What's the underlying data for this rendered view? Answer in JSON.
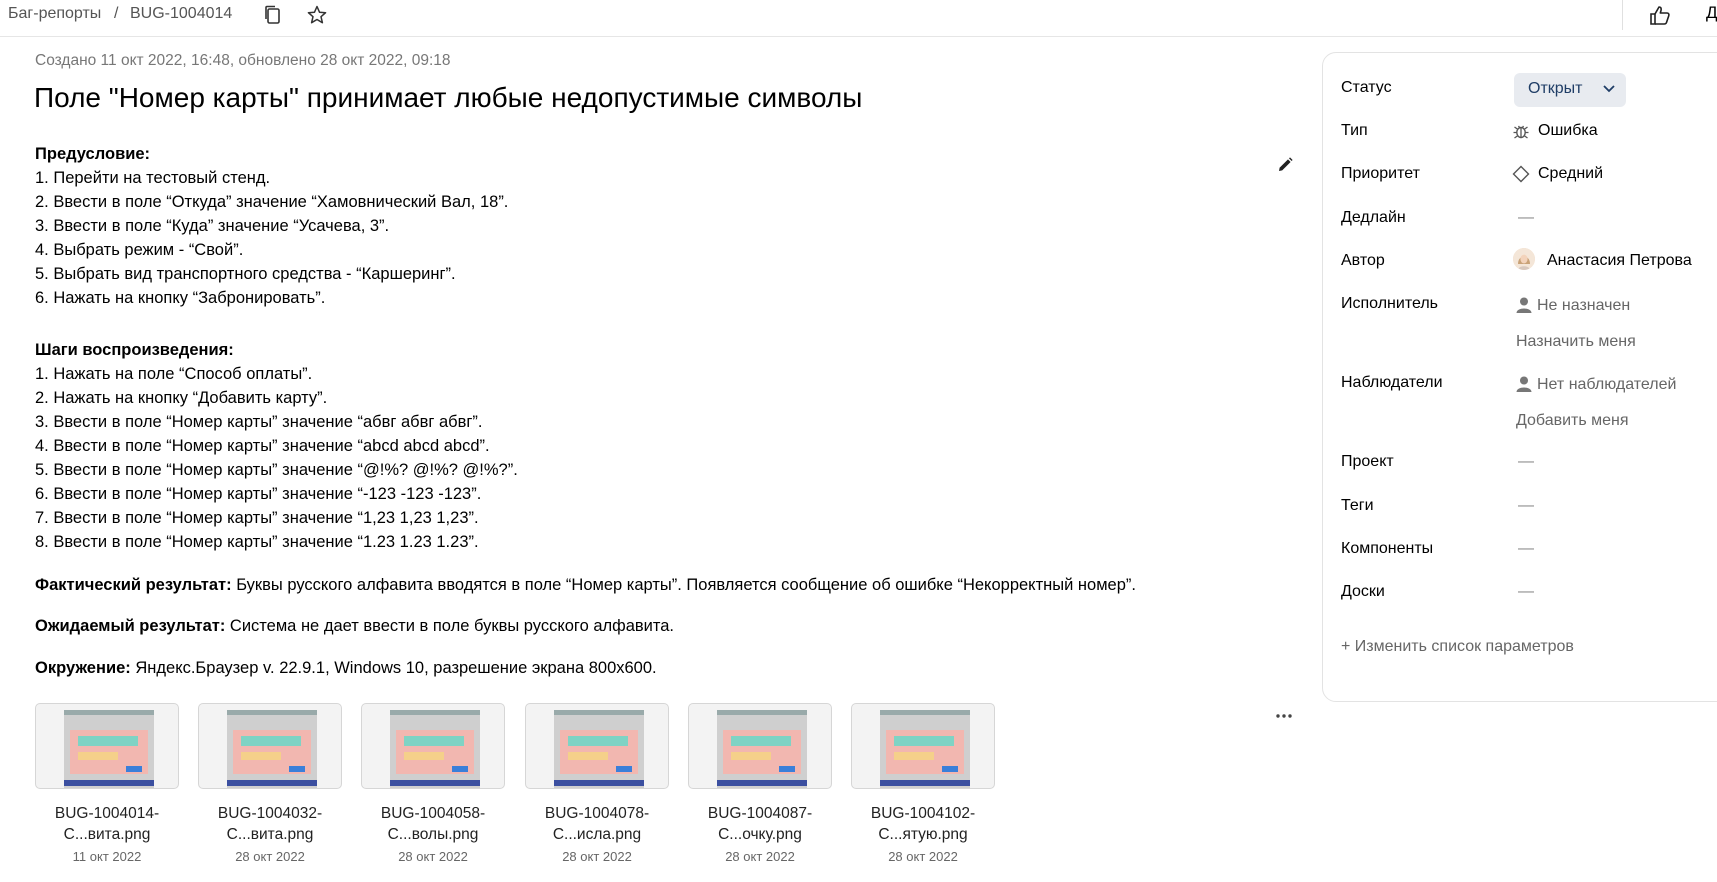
{
  "breadcrumb": {
    "parent": "Баг-репорты",
    "separator": "/",
    "current": "BUG-1004014"
  },
  "top_right_letter": "Д",
  "meta": "Создано 11 окт 2022, 16:48, обновлено 28 окт 2022, 09:18",
  "title": "Поле \"Номер карты\" принимает любые недопустимые символы",
  "precondition": {
    "header": "Предусловие:",
    "items": [
      "1. Перейти на тестовый стенд.",
      "2. Ввести в поле “Откуда” значение “Хамовнический Вал, 18”.",
      "3. Ввести в поле “Куда” значение “Усачева, 3”.",
      "4. Выбрать режим - “Свой”.",
      "5. Выбрать вид транспортного средства - “Каршеринг”.",
      "6. Нажать на кнопку “Забронировать”."
    ]
  },
  "steps": {
    "header": "Шаги воспроизведения:",
    "items": [
      "1. Нажать на поле “Способ оплаты”.",
      "2. Нажать на кнопку “Добавить карту”.",
      "3. Ввести в поле “Номер карты” значение “абвг абвг абвг”.",
      "4. Ввести в поле “Номер карты” значение “abcd abcd abcd”.",
      "5. Ввести в поле “Номер карты” значение “@!%? @!%? @!%?”.",
      "6. Ввести в поле “Номер карты” значение “-123 -123 -123”.",
      "7. Ввести в поле “Номер карты” значение “1,23 1,23 1,23”.",
      "8. Ввести в поле “Номер карты” значение “1.23 1.23 1.23”."
    ]
  },
  "actual": {
    "label": "Фактический результат:",
    "text": " Буквы русского алфавита вводятся в поле “Номер карты”. Появляется сообщение об ошибке “Некорректный номер”."
  },
  "expected": {
    "label": "Ожидаемый результат:",
    "text": " Система не дает ввести в поле буквы русского алфавита."
  },
  "environment": {
    "label": "Окружение:",
    "text": " Яндекс.Браузер v. 22.9.1, Windows 10, разрешение экрана 800х600."
  },
  "attachments": [
    {
      "line1": "BUG-1004014-",
      "line2": "С...вита.png",
      "date": "11 окт 2022"
    },
    {
      "line1": "BUG-1004032-",
      "line2": "С...вита.png",
      "date": "28 окт 2022"
    },
    {
      "line1": "BUG-1004058-",
      "line2": "С...волы.png",
      "date": "28 окт 2022"
    },
    {
      "line1": "BUG-1004078-",
      "line2": "С...исла.png",
      "date": "28 окт 2022"
    },
    {
      "line1": "BUG-1004087-",
      "line2": "С...очку.png",
      "date": "28 окт 2022"
    },
    {
      "line1": "BUG-1004102-",
      "line2": "С...ятую.png",
      "date": "28 окт 2022"
    }
  ],
  "sidebar": {
    "status": {
      "label": "Статус",
      "value": "Открыт"
    },
    "type": {
      "label": "Тип",
      "value": "Ошибка"
    },
    "priority": {
      "label": "Приоритет",
      "value": "Средний"
    },
    "deadline": {
      "label": "Дедлайн",
      "value": "—"
    },
    "author": {
      "label": "Автор",
      "value": "Анастасия Петрова"
    },
    "assignee": {
      "label": "Исполнитель",
      "value": "Не назначен",
      "action": "Назначить меня"
    },
    "followers": {
      "label": "Наблюдатели",
      "value": "Нет наблюдателей",
      "action": "Добавить меня"
    },
    "project": {
      "label": "Проект",
      "value": "—"
    },
    "tags": {
      "label": "Теги",
      "value": "—"
    },
    "components": {
      "label": "Компоненты",
      "value": "—"
    },
    "boards": {
      "label": "Доски",
      "value": "—"
    },
    "change_params": "+ Изменить список параметров"
  },
  "colors": {
    "status_bg": "#e8ebf0",
    "status_text": "#1f3d66",
    "muted": "#666666"
  }
}
